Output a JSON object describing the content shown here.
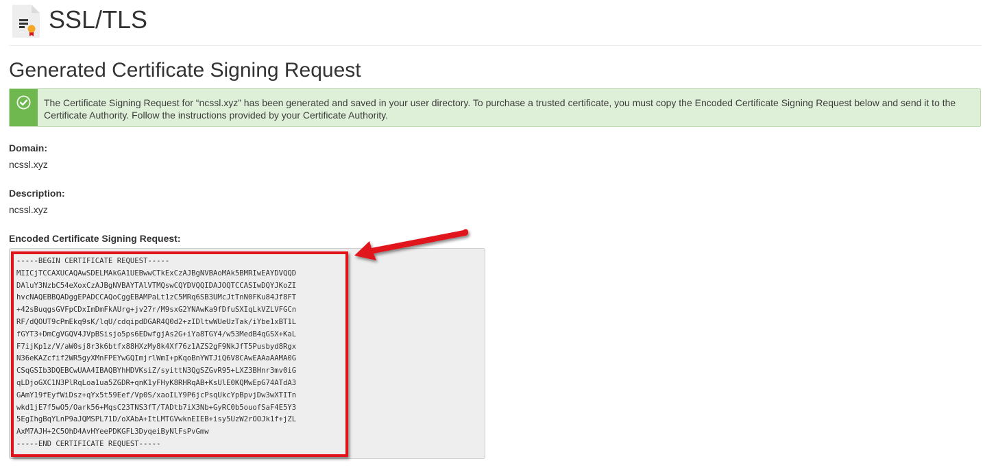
{
  "header": {
    "title": "SSL/TLS",
    "icon": "ssl-certificate-icon"
  },
  "section": {
    "title": "Generated Certificate Signing Request"
  },
  "alert": {
    "icon": "check-circle-icon",
    "color": "#6fb84f",
    "message": "The Certificate Signing Request for “ncssl.xyz” has been generated and saved in your user directory. To purchase a trusted certificate, you must copy the Encoded Certificate Signing Request below and send it to the Certificate Authority. Follow the instructions provided by your Certificate Authority."
  },
  "fields": {
    "domain_label": "Domain:",
    "domain_value": "ncssl.xyz",
    "description_label": "Description:",
    "description_value": "ncssl.xyz",
    "csr_label": "Encoded Certificate Signing Request:"
  },
  "csr": {
    "text": "-----BEGIN CERTIFICATE REQUEST-----\nMIICjTCCAXUCAQAwSDELMAkGA1UEBwwCTkExCzAJBgNVBAoMAk5BMRIwEAYDVQQD\nDAluY3NzbC54eXoxCzAJBgNVBAYTAlVTMQswCQYDVQQIDAJOQTCCASIwDQYJKoZI\nhvcNAQEBBQADggEPADCCAQoCggEBAMPaLt1zC5MRq6SB3UMcJtTnN0FKu84Jf8FT\n+42sBuqgsGVFpCDxImDmFkAUrg+jv27r/M9sxG2YNAwKa9fDfuSXIqLkVZLVFGCn\nRF/dQOUT9cPmEkq9sK/lqU/cdqipdDGAR4Q0d2+zIDltwWUeUzTak/iYbe1xBT1L\nfGYT3+DmCgVGQV4JVpBSisjo5ps6EDwfgjAs2G+iYa8TGY4/w53MedB4qGSX+KaL\nF7ijKp1z/V/aW0sj8r3k6btfx88HXzMy8k4Xf76z1AZS2gF9NkJfT5Pusbyd8Rgx\nN36eKAZcfif2WR5gyXMnFPEYwGQImjrlWmI+pKqoBnYWTJiQ6V8CAwEAAaAAMA0G\nCSqGSIb3DQEBCwUAA4IBAQBYhHDVKsiZ/syittN3QgSZGvR95+LXZ3BHnr3mv0iG\nqLDjoGXC1N3PlRqLoa1ua5ZGDR+qnK1yFHyK8RHRqAB+KsUlE0KQMwEpG74ATdA3\nGAmY19fEyfWiDsz+qYx5t59Eef/Vp0S/xaoILY9P6jcPsqUkcYpBpvjDw3wXTITn\nwkd1jE7f5wO5/Oark56+MqsC23TNS3fT/TADtb7iX3Nb+GyRC0b5ouofSaF4E5Y3\n5EgIhgBqYLnP9aJQMSPL71D/oXAbA+ItLMTGVwknEIEB+isy5UzW2rOOJk1f+jZL\nAxM7AJH+2C5OhD4AvHYeePDKGFL3DyqeiByNlFsPvGmw\n-----END CERTIFICATE REQUEST-----"
  },
  "annotation": {
    "highlight_color": "#e1141c",
    "arrow_icon": "red-arrow-icon"
  }
}
